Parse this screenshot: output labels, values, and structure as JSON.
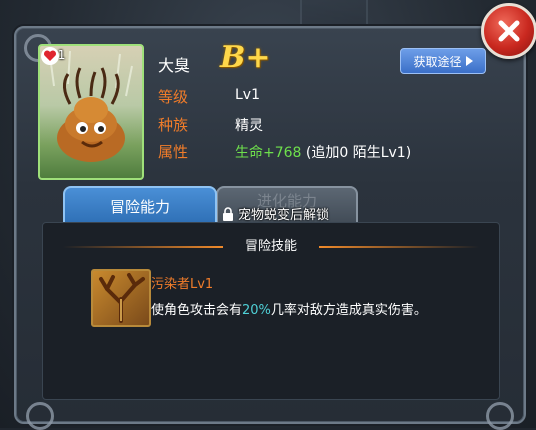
{
  "pet": {
    "portrait_level": "Lv1",
    "name": "大臭",
    "grade": "B+"
  },
  "attributes": [
    {
      "label": "等级",
      "value": "Lv1"
    },
    {
      "label": "种族",
      "value": "精灵"
    },
    {
      "label": "属性",
      "value_green": "生命+768",
      "value_extra": " (追加0 陌生Lv1)"
    }
  ],
  "obtain_button": {
    "label": "获取途径"
  },
  "tabs": {
    "active": "冒险能力",
    "inactive": "进化能力",
    "lock_text": "宠物蜕变后解锁"
  },
  "section": {
    "title": "冒险技能"
  },
  "skill": {
    "name": "污染者Lv1",
    "desc_before": "使角色攻击会有",
    "desc_pct": "20%",
    "desc_after": "几率对敌方造成真实伤害。"
  },
  "colors": {
    "accent_orange": "#f07c2a",
    "green": "#6ee04c",
    "cyan": "#4fd0d6",
    "tab_blue": "#2e6fb5"
  },
  "icons": [
    "close-icon",
    "heart-icon",
    "lock-icon",
    "arrow-right-icon",
    "skill-tree-icon"
  ]
}
